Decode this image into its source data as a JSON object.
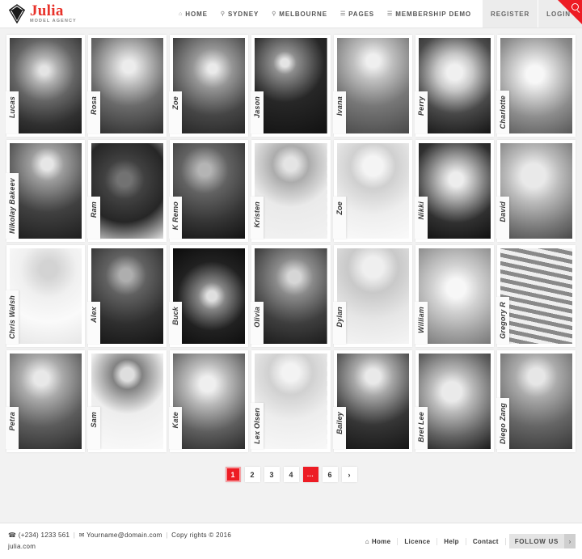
{
  "header": {
    "brand": {
      "name": "Julia",
      "tagline": "MODEL AGENCY",
      "icon": "diamond-icon"
    },
    "nav": [
      {
        "label": "HOME",
        "icon": "home-icon",
        "glyph": "⌂"
      },
      {
        "label": "SYDNEY",
        "icon": "pin-icon",
        "glyph": "⚲"
      },
      {
        "label": "MELBOURNE",
        "icon": "pin-icon",
        "glyph": "⚲"
      },
      {
        "label": "PAGES",
        "icon": "folder-icon",
        "glyph": "☰"
      },
      {
        "label": "MEMBERSHIP DEMO",
        "icon": "folder-icon",
        "glyph": "☰"
      }
    ],
    "register_label": "REGISTER",
    "login_label": "LOGIN",
    "search_icon": "search-icon",
    "accent_color": "#ed1c24"
  },
  "gallery": {
    "rows": [
      [
        {
          "name": "Lucas"
        },
        {
          "name": "Rosa"
        },
        {
          "name": "Zoe"
        },
        {
          "name": "Jason"
        },
        {
          "name": "Ivana"
        },
        {
          "name": "Perry"
        },
        {
          "name": "Charlotte"
        }
      ],
      [
        {
          "name": "Nikolay Bakeev"
        },
        {
          "name": "Ram"
        },
        {
          "name": "K Remo"
        },
        {
          "name": "Kristen"
        },
        {
          "name": "Zoe"
        },
        {
          "name": "Nikki"
        },
        {
          "name": "David"
        }
      ],
      [
        {
          "name": "Chris Walsh"
        },
        {
          "name": "Alex"
        },
        {
          "name": "Buck"
        },
        {
          "name": "Olivia"
        },
        {
          "name": "Dylan"
        },
        {
          "name": "William"
        },
        {
          "name": "Gregory R"
        }
      ],
      [
        {
          "name": "Petra"
        },
        {
          "name": "Sam"
        },
        {
          "name": "Kate"
        },
        {
          "name": "Lex Olsen"
        },
        {
          "name": "Bailey"
        },
        {
          "name": "Bret Lee"
        },
        {
          "name": "Diego Zang"
        }
      ]
    ]
  },
  "pagination": {
    "pages": [
      "1",
      "2",
      "3",
      "4",
      "...",
      "6",
      "›"
    ],
    "active_index": 0,
    "ellipsis_index": 4,
    "active_color": "#ed1c24"
  },
  "footer": {
    "phone": "(+234) 1233 561",
    "email": "Yourname@domain.com",
    "copyright": "Copy rights © 2016",
    "site": "julia.com",
    "separator": "|",
    "phone_icon": "phone-icon",
    "email_icon": "envelope-icon",
    "links": [
      {
        "label": "Home",
        "icon": "home-icon",
        "glyph": "⌂"
      },
      {
        "label": "Licence",
        "icon": "",
        "glyph": ""
      },
      {
        "label": "Help",
        "icon": "",
        "glyph": ""
      },
      {
        "label": "Contact",
        "icon": "",
        "glyph": ""
      }
    ],
    "follow_label": "FOLLOW US",
    "follow_arrow": "›"
  }
}
